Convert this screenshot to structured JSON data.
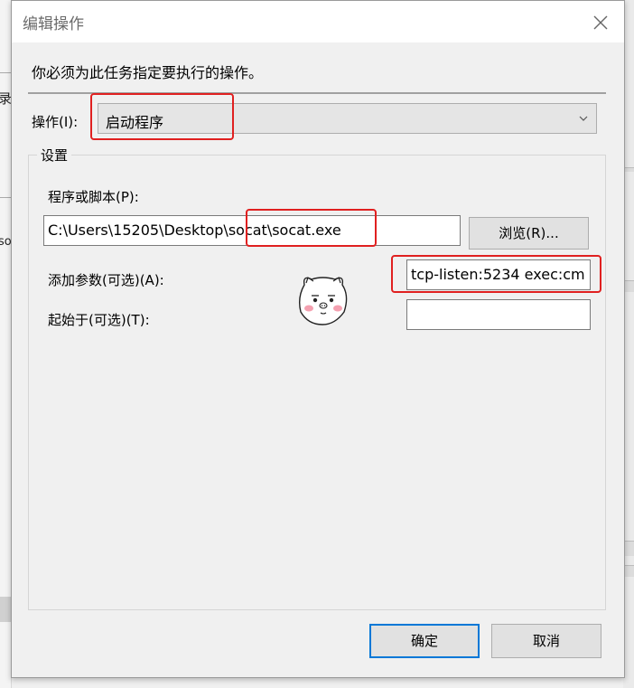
{
  "background": {
    "left_fragment_1": "录",
    "left_fragment_2": "so"
  },
  "dialog": {
    "title": "编辑操作",
    "instruction": "你必须为此任务指定要执行的操作。",
    "action_label": "操作(I):",
    "action_value": "启动程序",
    "settings_group": "设置",
    "program_label": "程序或脚本(P):",
    "program_value": "C:\\Users\\15205\\Desktop\\socat\\socat.exe",
    "browse_button": "浏览(R)...",
    "arguments_label": "添加参数(可选)(A):",
    "arguments_value": "tcp-listen:5234 exec:cm",
    "start_in_label": "起始于(可选)(T):",
    "start_in_value": "",
    "ok_button": "确定",
    "cancel_button": "取消"
  },
  "icons": {
    "close": "close-icon",
    "dropdown": "chevron-down-icon",
    "sticker": "pig-face-sticker-icon"
  },
  "colors": {
    "highlight": "#e02020",
    "default_button_border": "#0078d7"
  }
}
